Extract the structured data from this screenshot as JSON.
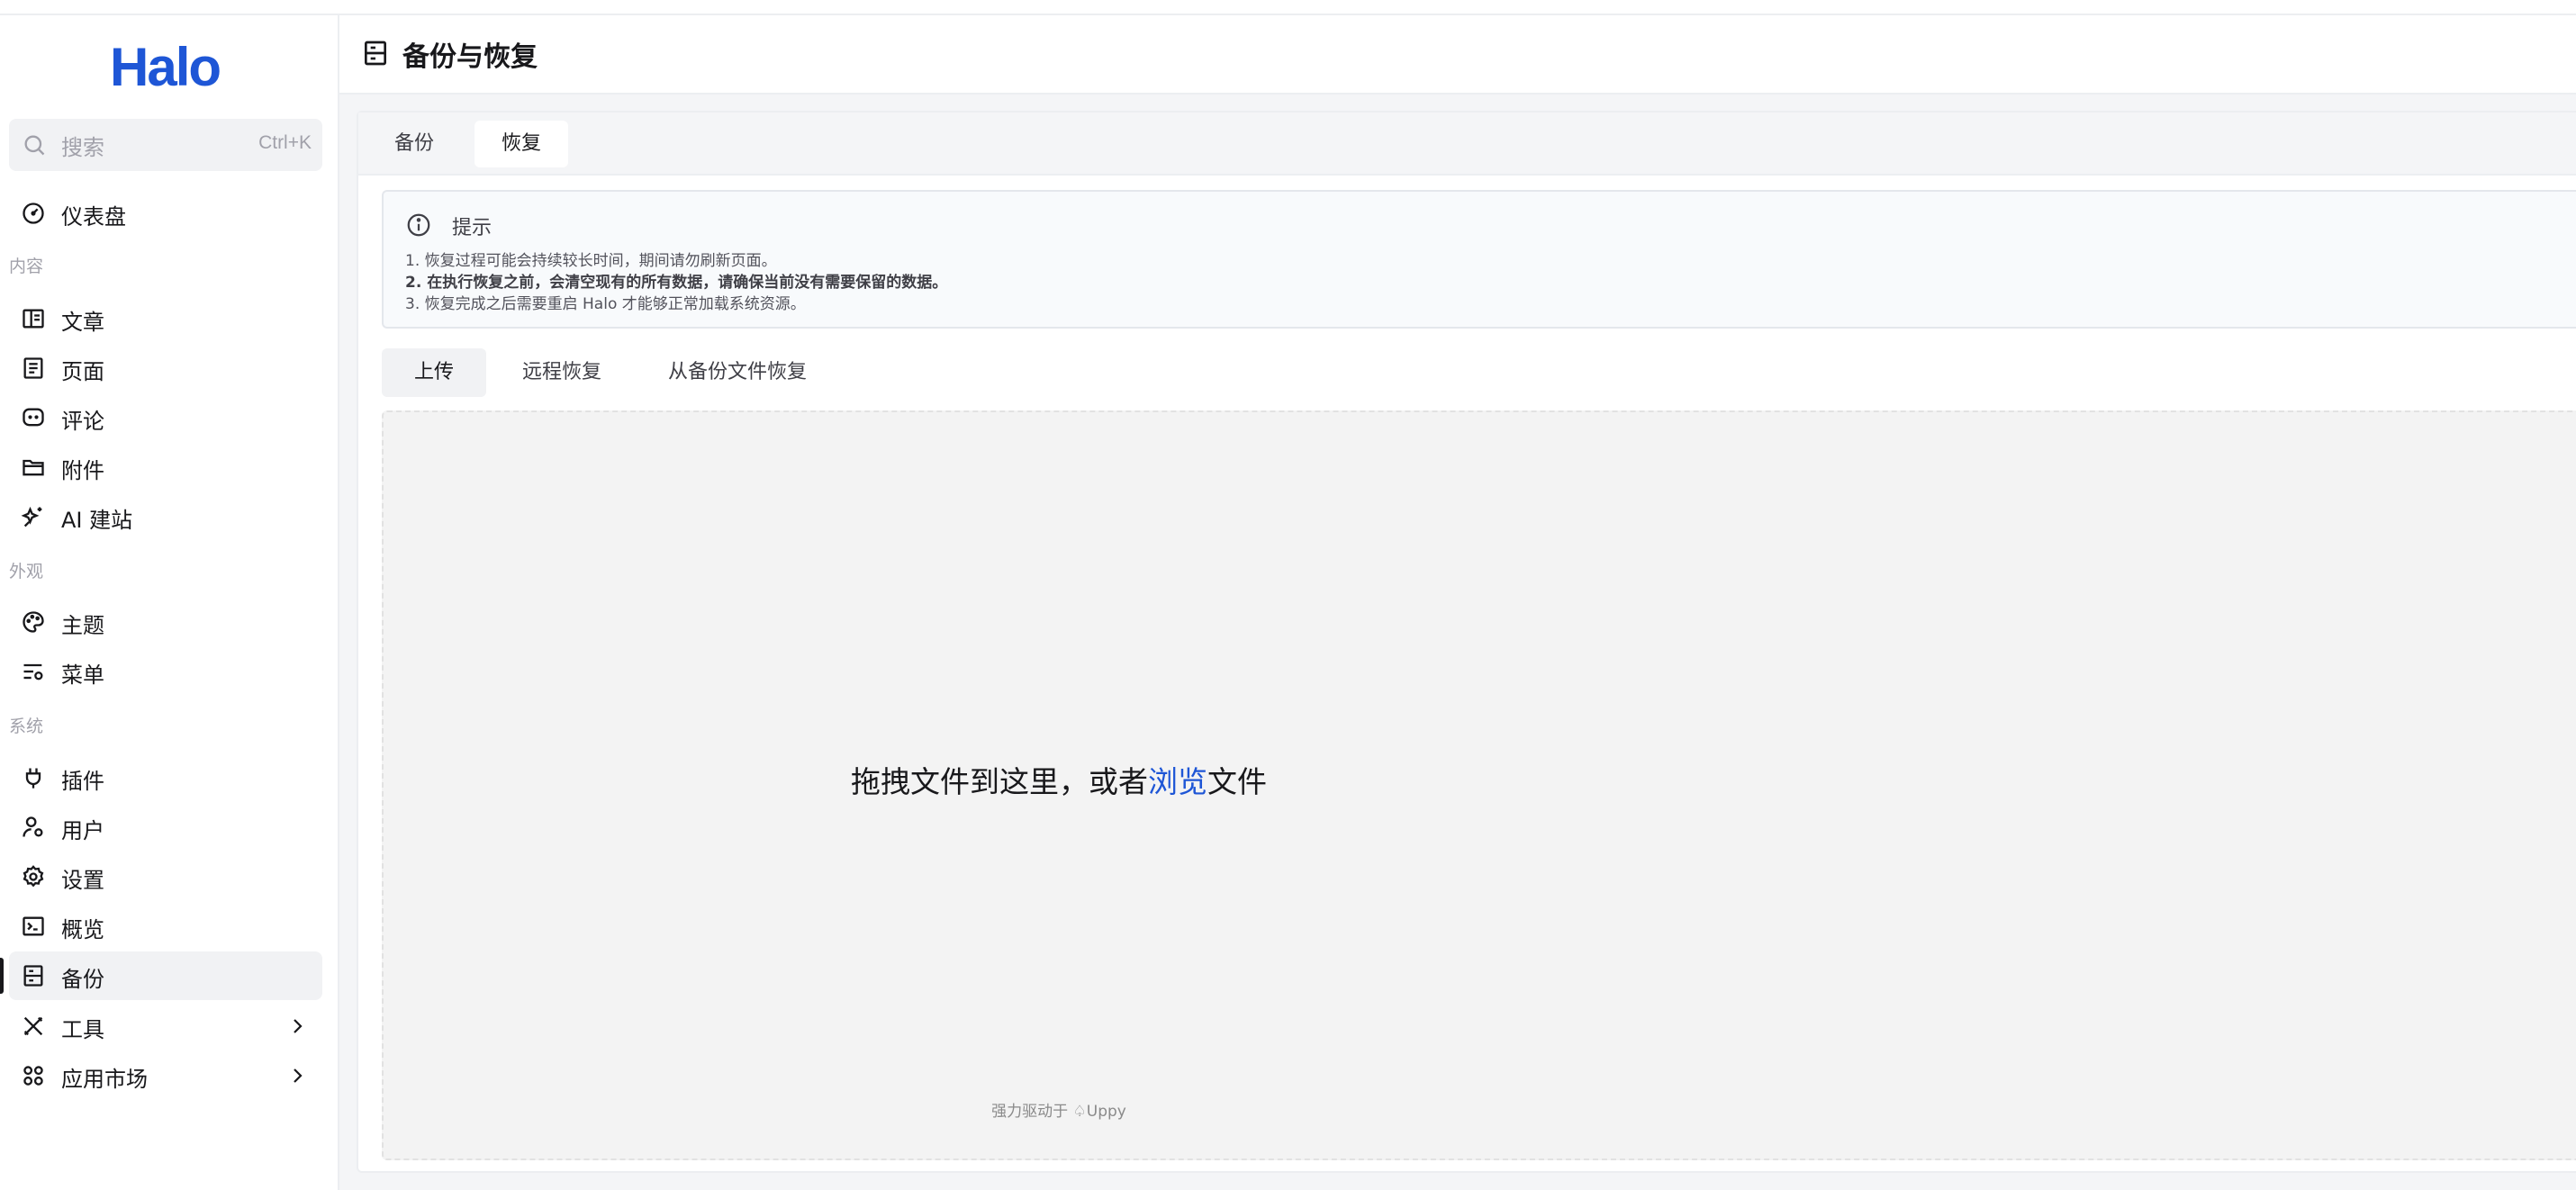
{
  "brand": {
    "logo_text": "Halo",
    "accent": "#1e56d6"
  },
  "search": {
    "placeholder": "搜索",
    "shortcut": "Ctrl+K"
  },
  "sidebar": {
    "dashboard": "仪表盘",
    "groups": {
      "content": "内容",
      "appearance": "外观",
      "system": "系统"
    },
    "items": {
      "posts": "文章",
      "pages": "页面",
      "comments": "评论",
      "attachments": "附件",
      "ai_site": "AI 建站",
      "themes": "主题",
      "menus": "菜单",
      "plugins": "插件",
      "users": "用户",
      "settings": "设置",
      "overview": "概览",
      "backup": "备份",
      "tools": "工具",
      "app_market": "应用市场"
    },
    "active": "backup"
  },
  "header": {
    "title": "备份与恢复"
  },
  "tabs": {
    "backup": "备份",
    "restore": "恢复",
    "active": "restore"
  },
  "alert": {
    "title": "提示",
    "lines": [
      "1. 恢复过程可能会持续较长时间，期间请勿刷新页面。",
      "2. 在执行恢复之前，会清空现有的所有数据，请确保当前没有需要保留的数据。",
      "3. 恢复完成之后需要重启 Halo 才能够正常加载系统资源。"
    ]
  },
  "subtabs": {
    "upload": "上传",
    "remote": "远程恢复",
    "from_file": "从备份文件恢复",
    "active": "upload"
  },
  "dropzone": {
    "text_before": "拖拽文件到这里，或者",
    "link": "浏览",
    "text_after": "文件",
    "powered_by": "强力驱动于 ♤Uppy"
  }
}
